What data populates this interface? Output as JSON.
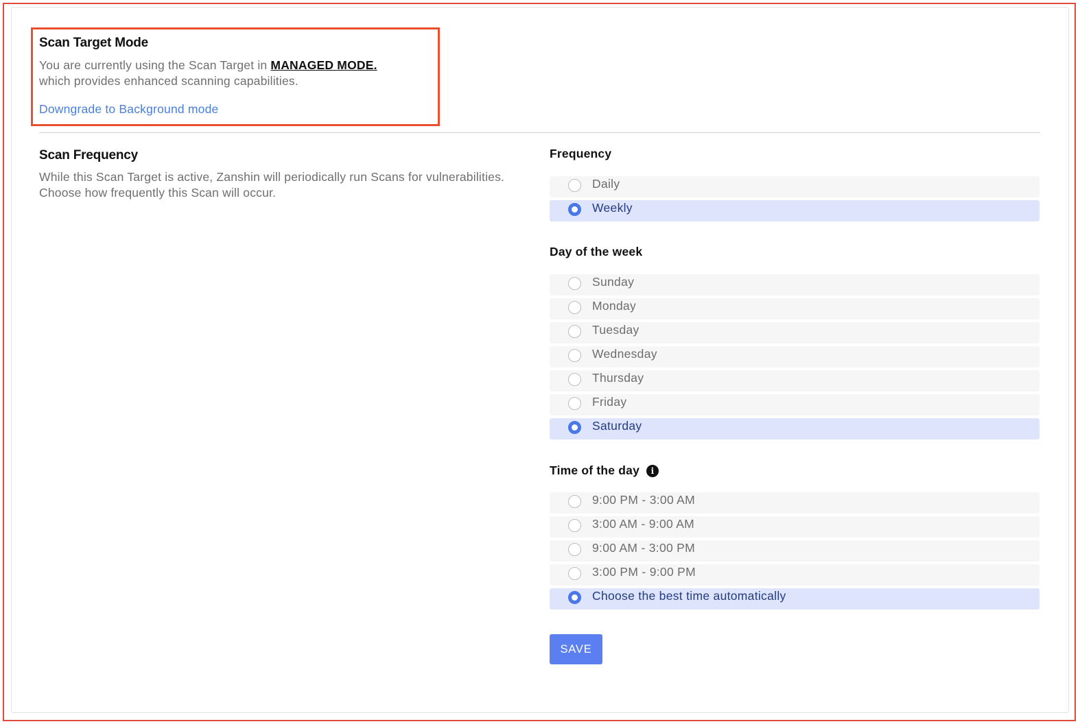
{
  "scan_target_mode": {
    "title": "Scan Target Mode",
    "description_prefix": "You are currently using the Scan Target in",
    "mode_name": "MANAGED MODE.",
    "description_suffix": "which provides enhanced scanning capabilities.",
    "downgrade_link": "Downgrade to Background mode"
  },
  "scan_frequency": {
    "title": "Scan Frequency",
    "description": "While this Scan Target is active, Zanshin will periodically run Scans for vulnerabilities. Choose how frequently this Scan will occur."
  },
  "frequency": {
    "label": "Frequency",
    "options": [
      {
        "label": "Daily",
        "selected": false
      },
      {
        "label": "Weekly",
        "selected": true
      }
    ]
  },
  "day_of_week": {
    "label": "Day of the week",
    "options": [
      {
        "label": "Sunday",
        "selected": false
      },
      {
        "label": "Monday",
        "selected": false
      },
      {
        "label": "Tuesday",
        "selected": false
      },
      {
        "label": "Wednesday",
        "selected": false
      },
      {
        "label": "Thursday",
        "selected": false
      },
      {
        "label": "Friday",
        "selected": false
      },
      {
        "label": "Saturday",
        "selected": true
      }
    ]
  },
  "time_of_day": {
    "label": "Time of the day",
    "info_icon": "info-icon",
    "options": [
      {
        "label": "9:00 PM - 3:00 AM",
        "selected": false
      },
      {
        "label": "3:00 AM - 9:00 AM",
        "selected": false
      },
      {
        "label": "9:00 AM - 3:00 PM",
        "selected": false
      },
      {
        "label": "3:00 PM - 9:00 PM",
        "selected": false
      },
      {
        "label": "Choose the best time automatically",
        "selected": true
      }
    ]
  },
  "save_label": "SAVE",
  "colors": {
    "accent": "#5b7ff0",
    "link": "#4a7fdc",
    "selected_bg": "#dee4fb",
    "highlight_border": "#e8502f"
  }
}
